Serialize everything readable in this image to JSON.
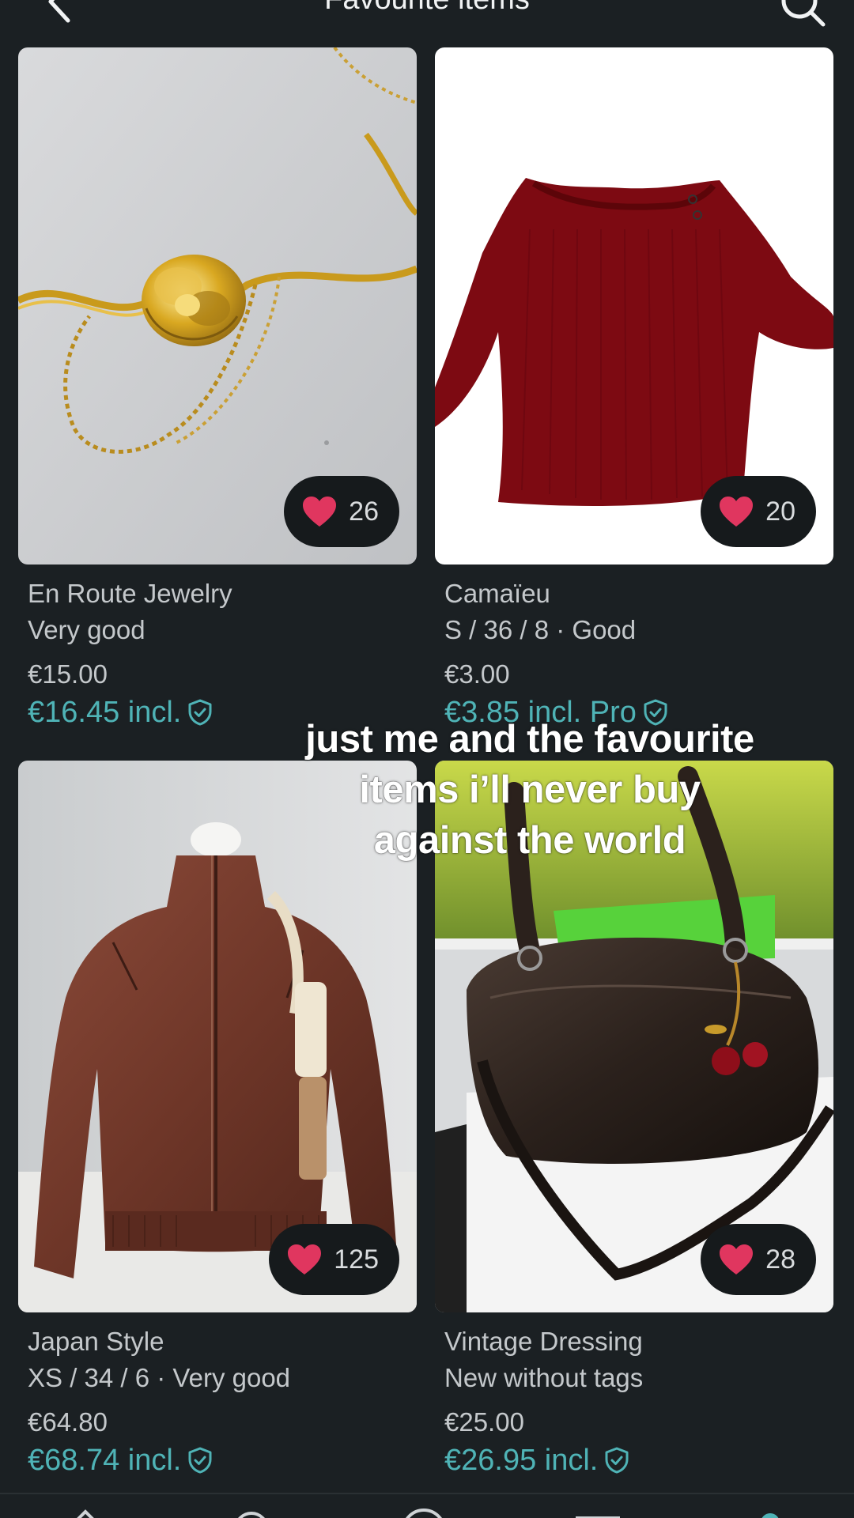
{
  "header": {
    "title": "Favourite items"
  },
  "overlay": {
    "caption_line1": "just me and the favourite",
    "caption_line2": "items i’ll never buy",
    "caption_line3": "against the world"
  },
  "colors": {
    "background": "#1b2023",
    "accent": "#4fb3b6",
    "heart": "#e0365f",
    "pill": "#161a1c"
  },
  "items": [
    {
      "brand": "En Route Jewelry",
      "details": "Very good",
      "price": "€15.00",
      "price_incl": "€16.45 incl.",
      "favourites": "26",
      "image": "gold rose chain necklace"
    },
    {
      "brand": "Camaïeu",
      "details": "S / 36 / 8 · Good",
      "price": "€3.00",
      "price_incl": "€3.85 incl. Pro",
      "favourites": "20",
      "image": "red ribbed off-shoulder top"
    },
    {
      "brand": "Japan Style",
      "details": "XS / 34 / 6 · Very good",
      "price": "€64.80",
      "price_incl": "€68.74 incl.",
      "favourites": "125",
      "image": "brown leather jacket on mannequin"
    },
    {
      "brand": "Vintage Dressing",
      "details": "New without tags",
      "price": "€25.00",
      "price_incl": "€26.95 incl.",
      "favourites": "28",
      "image": "dark brown leather shoulder bag with cherry charm"
    }
  ],
  "icons": {
    "back": "chevron-left-icon",
    "search": "search-icon",
    "heart": "heart-icon",
    "buyer_protection": "shield-check-icon"
  }
}
